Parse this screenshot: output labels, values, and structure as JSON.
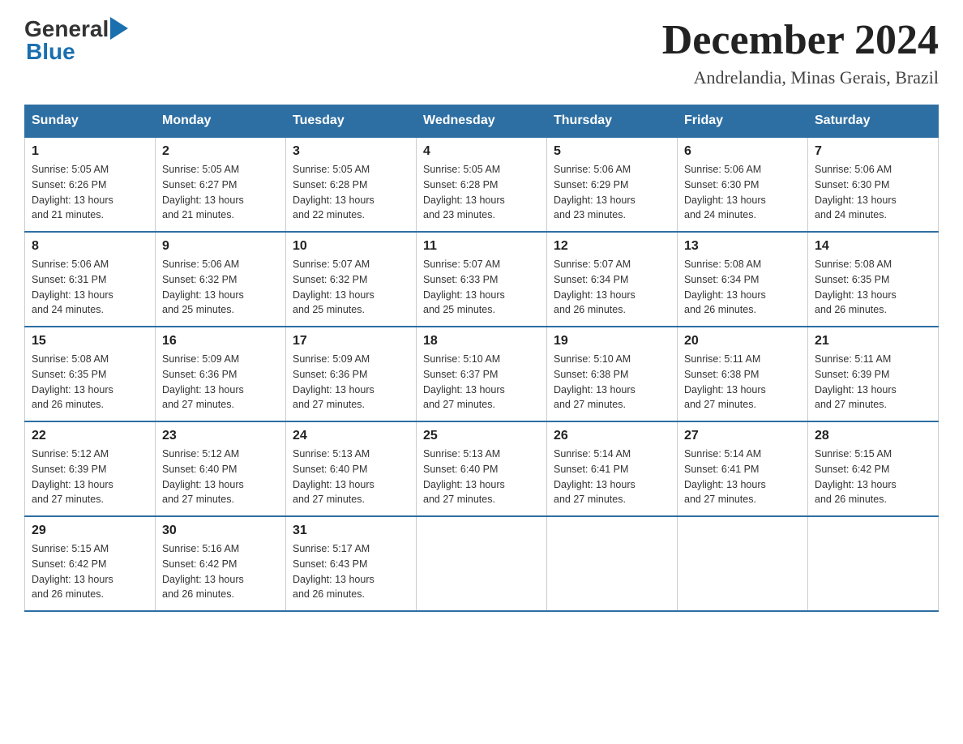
{
  "header": {
    "logo_general": "General",
    "logo_blue": "Blue",
    "month_title": "December 2024",
    "subtitle": "Andrelandia, Minas Gerais, Brazil"
  },
  "days_of_week": [
    "Sunday",
    "Monday",
    "Tuesday",
    "Wednesday",
    "Thursday",
    "Friday",
    "Saturday"
  ],
  "weeks": [
    [
      {
        "day": "1",
        "sunrise": "5:05 AM",
        "sunset": "6:26 PM",
        "daylight": "13 hours and 21 minutes."
      },
      {
        "day": "2",
        "sunrise": "5:05 AM",
        "sunset": "6:27 PM",
        "daylight": "13 hours and 21 minutes."
      },
      {
        "day": "3",
        "sunrise": "5:05 AM",
        "sunset": "6:28 PM",
        "daylight": "13 hours and 22 minutes."
      },
      {
        "day": "4",
        "sunrise": "5:05 AM",
        "sunset": "6:28 PM",
        "daylight": "13 hours and 23 minutes."
      },
      {
        "day": "5",
        "sunrise": "5:06 AM",
        "sunset": "6:29 PM",
        "daylight": "13 hours and 23 minutes."
      },
      {
        "day": "6",
        "sunrise": "5:06 AM",
        "sunset": "6:30 PM",
        "daylight": "13 hours and 24 minutes."
      },
      {
        "day": "7",
        "sunrise": "5:06 AM",
        "sunset": "6:30 PM",
        "daylight": "13 hours and 24 minutes."
      }
    ],
    [
      {
        "day": "8",
        "sunrise": "5:06 AM",
        "sunset": "6:31 PM",
        "daylight": "13 hours and 24 minutes."
      },
      {
        "day": "9",
        "sunrise": "5:06 AM",
        "sunset": "6:32 PM",
        "daylight": "13 hours and 25 minutes."
      },
      {
        "day": "10",
        "sunrise": "5:07 AM",
        "sunset": "6:32 PM",
        "daylight": "13 hours and 25 minutes."
      },
      {
        "day": "11",
        "sunrise": "5:07 AM",
        "sunset": "6:33 PM",
        "daylight": "13 hours and 25 minutes."
      },
      {
        "day": "12",
        "sunrise": "5:07 AM",
        "sunset": "6:34 PM",
        "daylight": "13 hours and 26 minutes."
      },
      {
        "day": "13",
        "sunrise": "5:08 AM",
        "sunset": "6:34 PM",
        "daylight": "13 hours and 26 minutes."
      },
      {
        "day": "14",
        "sunrise": "5:08 AM",
        "sunset": "6:35 PM",
        "daylight": "13 hours and 26 minutes."
      }
    ],
    [
      {
        "day": "15",
        "sunrise": "5:08 AM",
        "sunset": "6:35 PM",
        "daylight": "13 hours and 26 minutes."
      },
      {
        "day": "16",
        "sunrise": "5:09 AM",
        "sunset": "6:36 PM",
        "daylight": "13 hours and 27 minutes."
      },
      {
        "day": "17",
        "sunrise": "5:09 AM",
        "sunset": "6:36 PM",
        "daylight": "13 hours and 27 minutes."
      },
      {
        "day": "18",
        "sunrise": "5:10 AM",
        "sunset": "6:37 PM",
        "daylight": "13 hours and 27 minutes."
      },
      {
        "day": "19",
        "sunrise": "5:10 AM",
        "sunset": "6:38 PM",
        "daylight": "13 hours and 27 minutes."
      },
      {
        "day": "20",
        "sunrise": "5:11 AM",
        "sunset": "6:38 PM",
        "daylight": "13 hours and 27 minutes."
      },
      {
        "day": "21",
        "sunrise": "5:11 AM",
        "sunset": "6:39 PM",
        "daylight": "13 hours and 27 minutes."
      }
    ],
    [
      {
        "day": "22",
        "sunrise": "5:12 AM",
        "sunset": "6:39 PM",
        "daylight": "13 hours and 27 minutes."
      },
      {
        "day": "23",
        "sunrise": "5:12 AM",
        "sunset": "6:40 PM",
        "daylight": "13 hours and 27 minutes."
      },
      {
        "day": "24",
        "sunrise": "5:13 AM",
        "sunset": "6:40 PM",
        "daylight": "13 hours and 27 minutes."
      },
      {
        "day": "25",
        "sunrise": "5:13 AM",
        "sunset": "6:40 PM",
        "daylight": "13 hours and 27 minutes."
      },
      {
        "day": "26",
        "sunrise": "5:14 AM",
        "sunset": "6:41 PM",
        "daylight": "13 hours and 27 minutes."
      },
      {
        "day": "27",
        "sunrise": "5:14 AM",
        "sunset": "6:41 PM",
        "daylight": "13 hours and 27 minutes."
      },
      {
        "day": "28",
        "sunrise": "5:15 AM",
        "sunset": "6:42 PM",
        "daylight": "13 hours and 26 minutes."
      }
    ],
    [
      {
        "day": "29",
        "sunrise": "5:15 AM",
        "sunset": "6:42 PM",
        "daylight": "13 hours and 26 minutes."
      },
      {
        "day": "30",
        "sunrise": "5:16 AM",
        "sunset": "6:42 PM",
        "daylight": "13 hours and 26 minutes."
      },
      {
        "day": "31",
        "sunrise": "5:17 AM",
        "sunset": "6:43 PM",
        "daylight": "13 hours and 26 minutes."
      },
      null,
      null,
      null,
      null
    ]
  ],
  "labels": {
    "sunrise": "Sunrise:",
    "sunset": "Sunset:",
    "daylight": "Daylight:"
  }
}
